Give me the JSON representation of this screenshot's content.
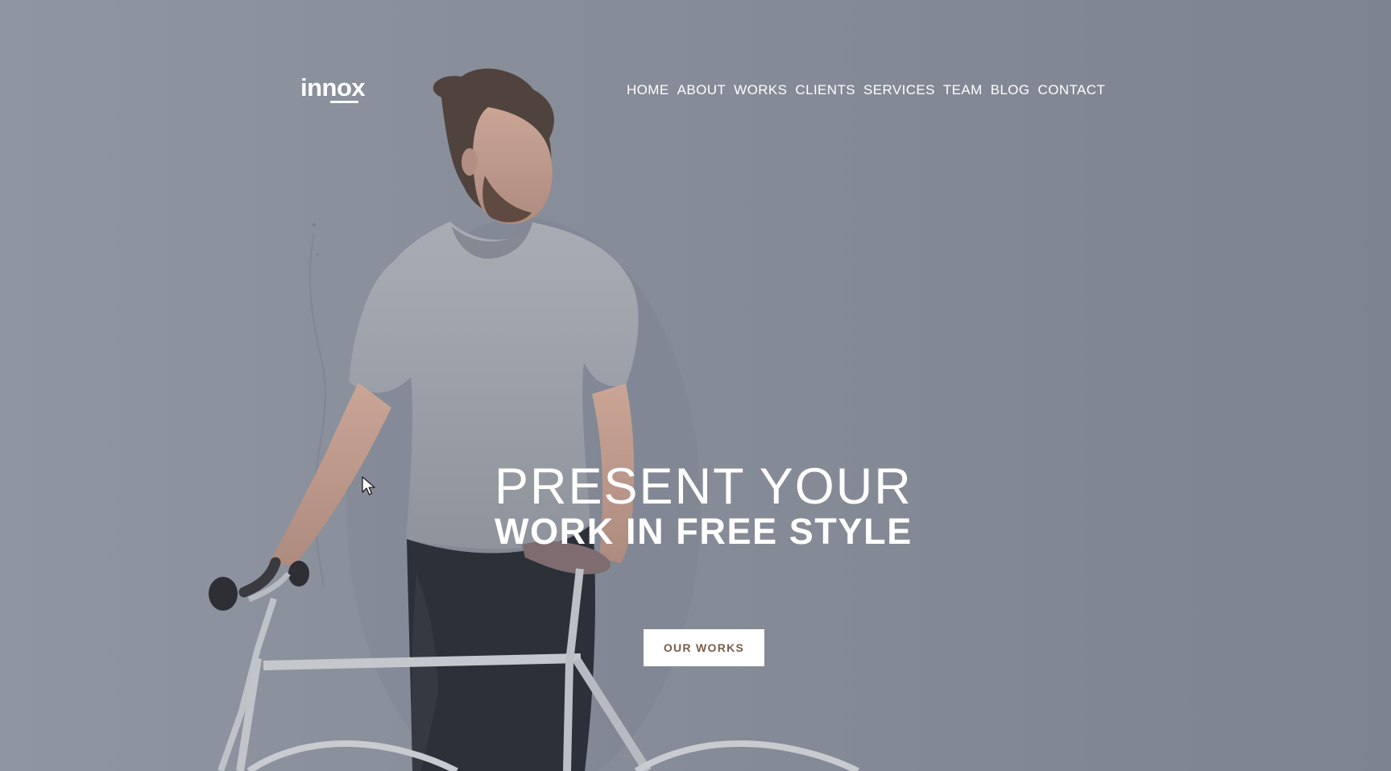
{
  "brand": {
    "logo_text": "innox"
  },
  "nav": {
    "items": [
      "HOME",
      "ABOUT",
      "WORKS",
      "CLIENTS",
      "SERVICES",
      "TEAM",
      "BLOG",
      "CONTACT"
    ]
  },
  "hero": {
    "headline_line1": "PRESENT YOUR",
    "headline_line2": "WORK IN FREE STYLE",
    "cta_label": "OUR WORKS"
  },
  "colors": {
    "overlay": "#858b97",
    "text": "#ffffff",
    "button_text": "#7a5e4a"
  },
  "icons": {
    "cursor": "mouse-pointer-icon"
  }
}
